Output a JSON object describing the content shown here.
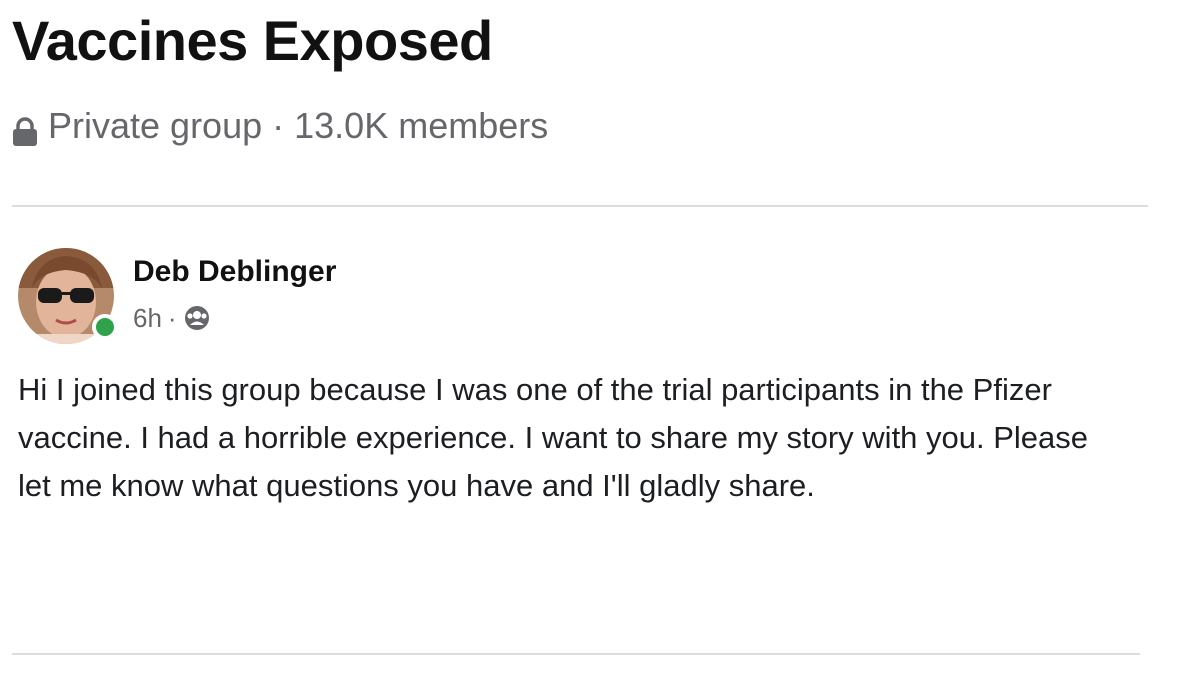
{
  "group": {
    "title": "Vaccines Exposed",
    "privacy": "Private group",
    "separator": "·",
    "members": "13.0K members",
    "privacy_icon": "lock-icon"
  },
  "post": {
    "author": "Deb Deblinger",
    "time": "6h",
    "separator": "·",
    "audience_icon": "group-audience-icon",
    "online_status_color": "#31a24c",
    "body": "Hi I joined this group because I was one of the trial participants in the Pfizer vaccine. I had a horrible experience. I want to share my story with you. Please let me know what questions you have and I'll gladly share."
  },
  "colors": {
    "title_text": "#111111",
    "secondary_text": "#65676b",
    "divider": "#dadde1"
  }
}
